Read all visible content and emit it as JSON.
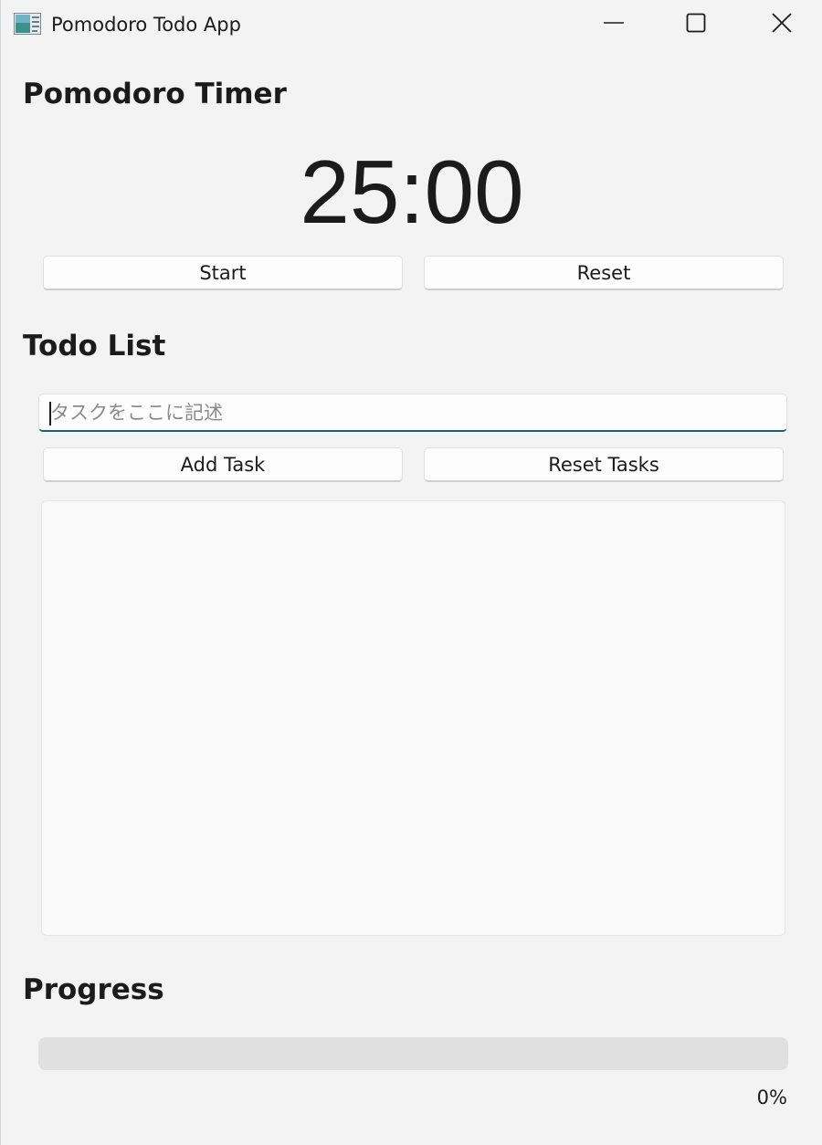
{
  "window": {
    "title": "Pomodoro Todo App",
    "minimize_icon": "minimize-icon",
    "maximize_icon": "maximize-icon",
    "close_icon": "close-icon"
  },
  "timer": {
    "heading": "Pomodoro Timer",
    "display": "25:00",
    "start_label": "Start",
    "reset_label": "Reset"
  },
  "todo": {
    "heading": "Todo List",
    "input_value": "",
    "input_placeholder": "タスクをここに記述",
    "add_label": "Add Task",
    "reset_label": "Reset Tasks",
    "tasks": []
  },
  "progress": {
    "heading": "Progress",
    "value": 0,
    "label": "0%"
  },
  "colors": {
    "background": "#f3f3f3",
    "input_focus_underline": "#1f5f74",
    "progress_track": "#e0e0e0"
  }
}
